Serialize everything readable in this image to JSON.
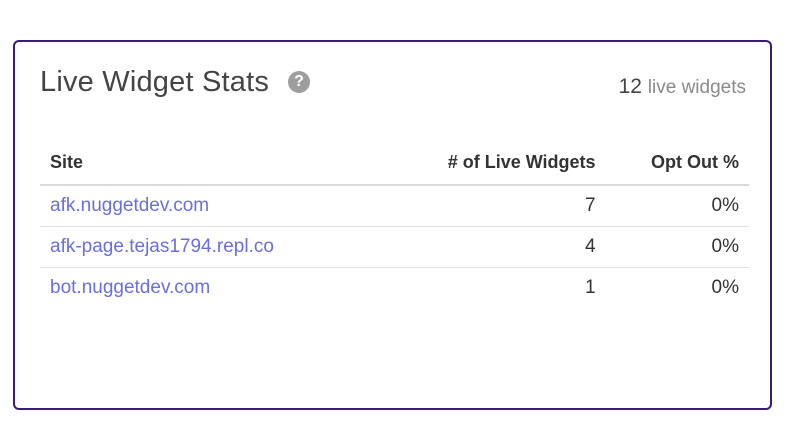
{
  "card": {
    "title": "Live Widget Stats",
    "help_icon": "question-circle-icon",
    "summary_count": "12",
    "summary_unit": "live widgets",
    "border_color": "#3b1a7a",
    "link_color": "#6a6ee0"
  },
  "table": {
    "headers": [
      "Site",
      "# of Live Widgets",
      "Opt Out %"
    ],
    "rows": [
      {
        "site": "afk.nuggetdev.com",
        "live_widgets": "7",
        "opt_out": "0%"
      },
      {
        "site": "afk-page.tejas1794.repl.co",
        "live_widgets": "4",
        "opt_out": "0%"
      },
      {
        "site": "bot.nuggetdev.com",
        "live_widgets": "1",
        "opt_out": "0%"
      }
    ]
  }
}
